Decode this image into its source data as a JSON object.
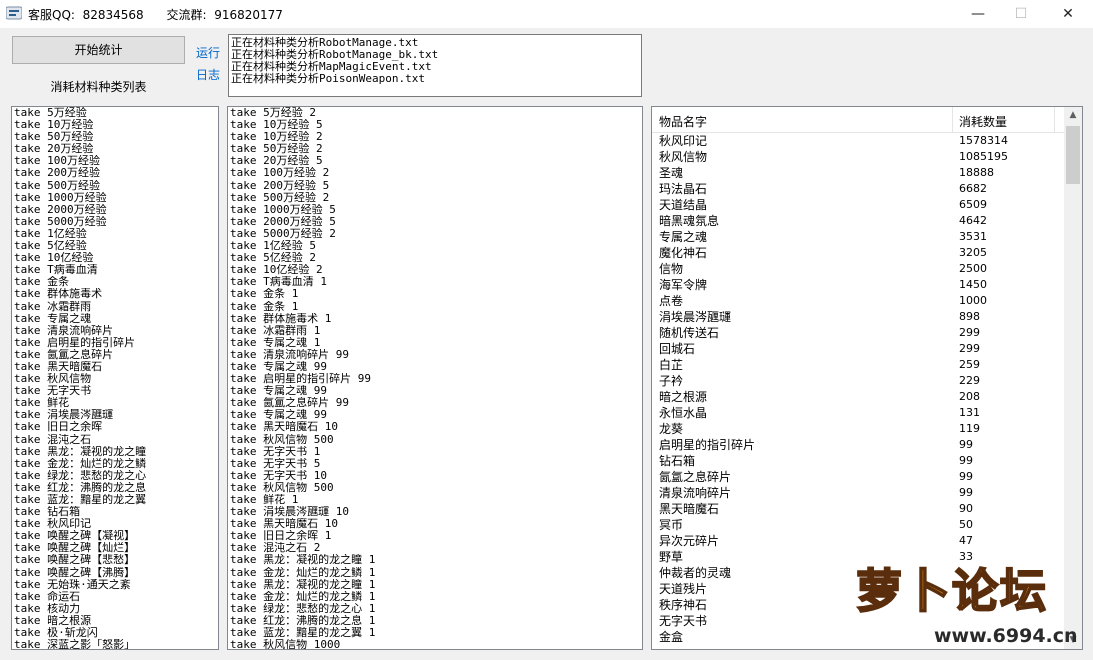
{
  "window": {
    "title": "客服QQ:  82834568      交流群:  916820177",
    "minimize_icon": "minimize-icon",
    "maximize_icon": "maximize-icon",
    "close_icon": "close-icon"
  },
  "controls": {
    "start_button": "开始统计",
    "list_label": "消耗材料种类列表",
    "run_link": "运行",
    "log_link": "日志"
  },
  "log_lines": [
    "正在材料种类分析RobotManage.txt",
    "正在材料种类分析RobotManage_bk.txt",
    "正在材料种类分析MapMagicEvent.txt",
    "正在材料种类分析PoisonWeapon.txt"
  ],
  "list1": [
    "take 5万经验",
    "take 10万经验",
    "take 50万经验",
    "take 20万经验",
    "take 100万经验",
    "take 200万经验",
    "take 500万经验",
    "take 1000万经验",
    "take 2000万经验",
    "take 5000万经验",
    "take 1亿经验",
    "take 5亿经验",
    "take 10亿经验",
    "take T病毒血清",
    "take 金条",
    "take 群体施毒术",
    "take 冰霜群雨",
    "take 专属之魂",
    "take 清泉流响碎片",
    "take 启明星的指引碎片",
    "take 氤氲之息碎片",
    "take 黑天暗魔石",
    "take 秋风信物",
    "take 无字天书",
    "take 鲜花",
    "take 涓埃晨涔甅璭",
    "take 旧日之余晖",
    "take 混沌之石",
    "take 黑龙：凝视的龙之瞳",
    "take 金龙：灿烂的龙之鳞",
    "take 绿龙：悲愁的龙之心",
    "take 红龙：沸腾的龙之息",
    "take 蓝龙：黯星的龙之翼",
    "take 钻石箱",
    "take 秋风印记",
    "take 唤醒之碑【凝视】",
    "take 唤醒之碑【灿烂】",
    "take 唤醒之碑【悲愁】",
    "take 唤醒之碑【沸腾】",
    "take 无始珠·通天之紊",
    "take 命运石",
    "take 核动力",
    "take 暗之根源",
    "take 极·斩龙闪",
    "take 深蓝之影「怒影」"
  ],
  "list2": [
    "take 5万经验 2",
    "take 10万经验 5",
    "take 10万经验 2",
    "take 50万经验 2",
    "take 20万经验 5",
    "take 100万经验 2",
    "take 200万经验 5",
    "take 500万经验 2",
    "take 1000万经验 5",
    "take 2000万经验 5",
    "take 5000万经验 2",
    "take 1亿经验 5",
    "take 5亿经验 2",
    "take 10亿经验 2",
    "take T病毒血清 1",
    "take 金条 1",
    "take 金条 1",
    "take 群体施毒术 1",
    "take 冰霜群雨 1",
    "take 专属之魂 1",
    "take 清泉流响碎片 99",
    "take 专属之魂 99",
    "take 启明星的指引碎片 99",
    "take 专属之魂 99",
    "take 氤氲之息碎片 99",
    "take 专属之魂 99",
    "take 黑天暗魔石 10",
    "take 秋风信物 500",
    "take 无字天书 1",
    "take 无字天书 5",
    "take 无字天书 10",
    "take 秋风信物 500",
    "take 鲜花 1",
    "take 涓埃晨涔甅璭 10",
    "take 黑天暗魔石 10",
    "take 旧日之余晖 1",
    "take 混沌之石 2",
    "take 黑龙：凝视的龙之瞳 1",
    "take 金龙：灿烂的龙之鳞 1",
    "take 黑龙：凝视的龙之瞳 1",
    "take 金龙：灿烂的龙之鳞 1",
    "take 绿龙：悲愁的龙之心 1",
    "take 红龙：沸腾的龙之息 1",
    "take 蓝龙：黯星的龙之翼 1",
    "take 秋风信物 1000"
  ],
  "grid": {
    "col_name": "物品名字",
    "col_qty": "消耗数量",
    "rows": [
      {
        "name": "秋风印记",
        "qty": "1578314"
      },
      {
        "name": "秋风信物",
        "qty": "1085195"
      },
      {
        "name": "圣魂",
        "qty": "18888"
      },
      {
        "name": "玛法晶石",
        "qty": "6682"
      },
      {
        "name": "天道结晶",
        "qty": "6509"
      },
      {
        "name": "暗黑魂氛息",
        "qty": "4642"
      },
      {
        "name": "专属之魂",
        "qty": "3531"
      },
      {
        "name": "魔化神石",
        "qty": "3205"
      },
      {
        "name": "信物",
        "qty": "2500"
      },
      {
        "name": "海军令牌",
        "qty": "1450"
      },
      {
        "name": "点卷",
        "qty": "1000"
      },
      {
        "name": "涓埃晨涔甅璭",
        "qty": "898"
      },
      {
        "name": "随机传送石",
        "qty": "299"
      },
      {
        "name": "回城石",
        "qty": "299"
      },
      {
        "name": "白芷",
        "qty": "259"
      },
      {
        "name": "子衿",
        "qty": "229"
      },
      {
        "name": "暗之根源",
        "qty": "208"
      },
      {
        "name": "永恒水晶",
        "qty": "131"
      },
      {
        "name": "龙葵",
        "qty": "119"
      },
      {
        "name": "启明星的指引碎片",
        "qty": "99"
      },
      {
        "name": "钻石箱",
        "qty": "99"
      },
      {
        "name": "氤氲之息碎片",
        "qty": "99"
      },
      {
        "name": "清泉流响碎片",
        "qty": "99"
      },
      {
        "name": "黑天暗魔石",
        "qty": "90"
      },
      {
        "name": "冥币",
        "qty": "50"
      },
      {
        "name": "异次元碎片",
        "qty": "47"
      },
      {
        "name": "野草",
        "qty": "33"
      },
      {
        "name": "仲裁者的灵魂",
        "qty": ""
      },
      {
        "name": "天道残片",
        "qty": ""
      },
      {
        "name": "秩序神石",
        "qty": ""
      },
      {
        "name": "无字天书",
        "qty": ""
      },
      {
        "name": "金盒",
        "qty": ""
      }
    ]
  },
  "watermark": {
    "text": "萝卜论坛",
    "url": "www.6994.cn"
  }
}
